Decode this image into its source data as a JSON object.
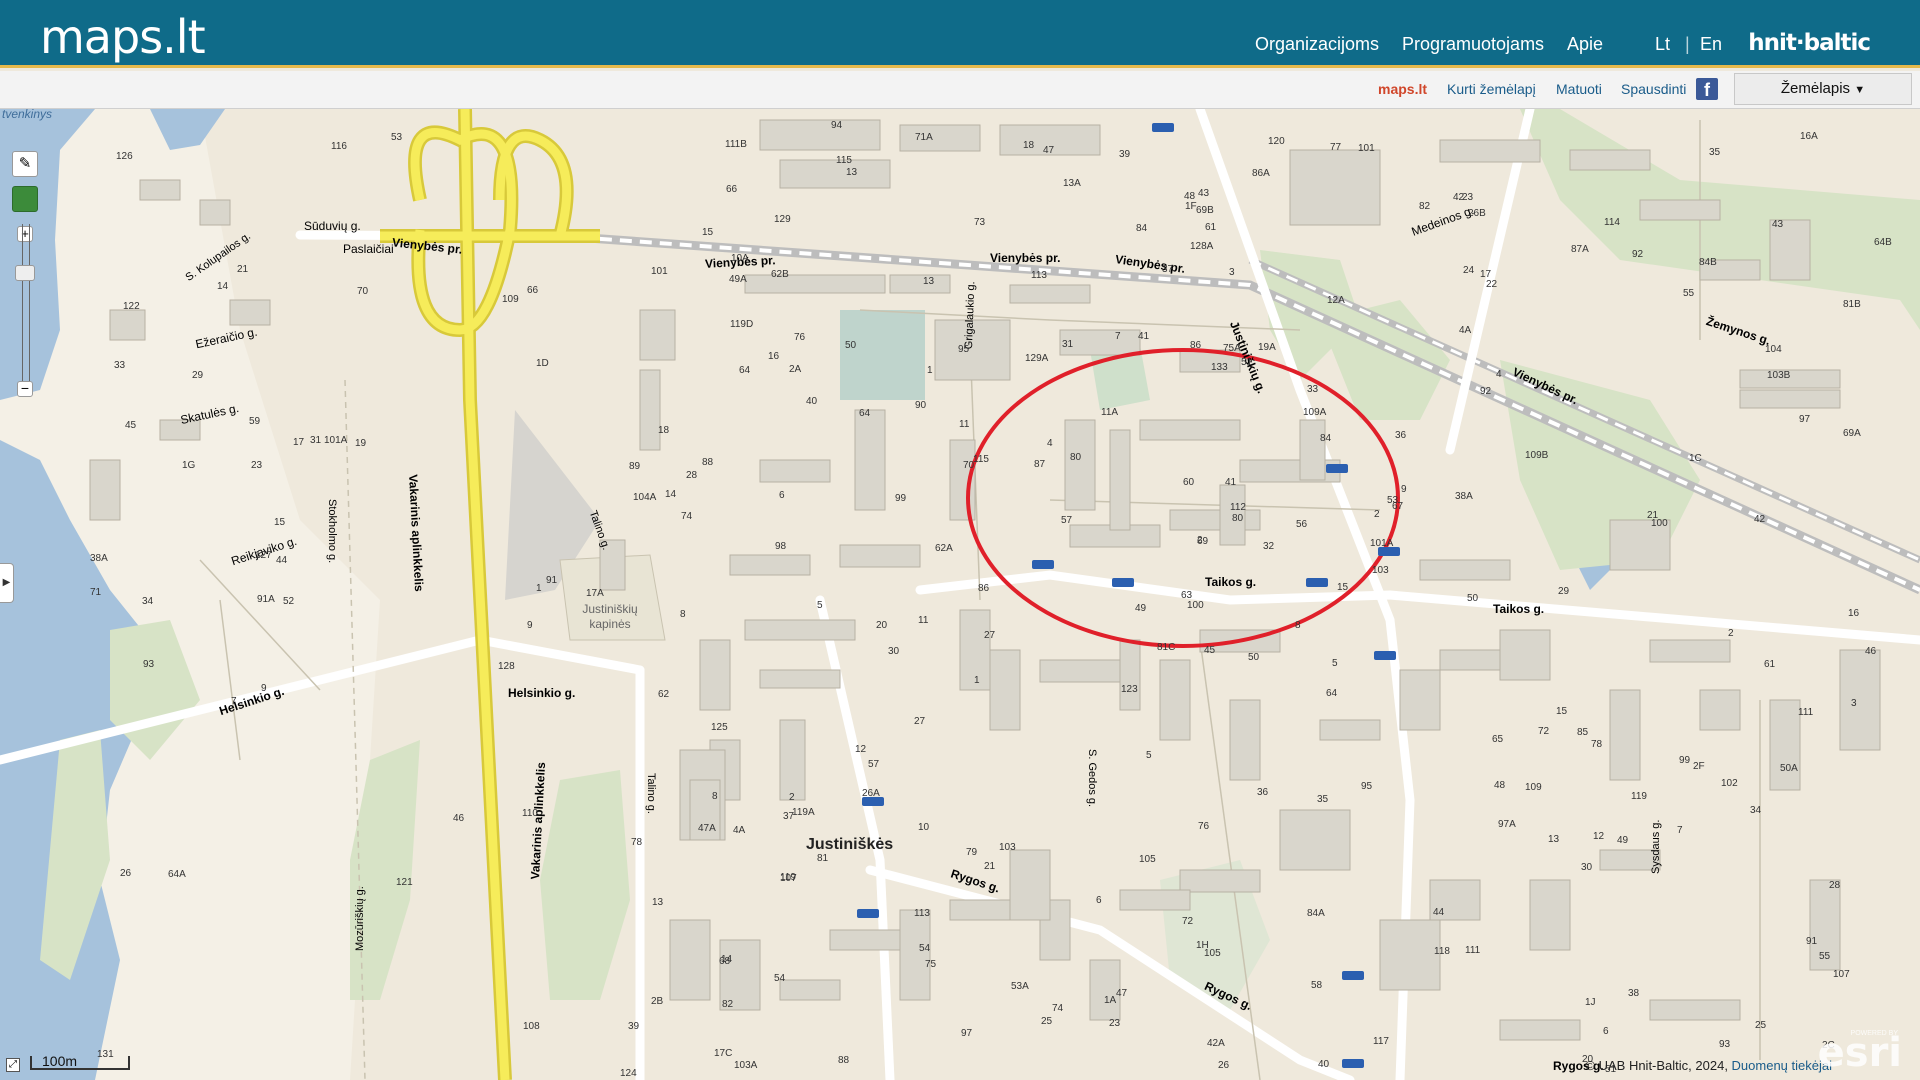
{
  "header": {
    "logo": "maps.lt",
    "nav": [
      "Organizacijoms",
      "Programuotojams",
      "Apie"
    ],
    "lang_lt": "Lt",
    "lang_sep": "|",
    "lang_en": "En",
    "brand": "hnit·baltic"
  },
  "toolbar": {
    "home": "maps.lt",
    "create_map": "Kurti žemėlapį",
    "measure": "Matuoti",
    "print": "Spausdinti",
    "facebook_icon": "facebook-icon",
    "layer_select": "Žemėlapis"
  },
  "map": {
    "district": "Justiniškės",
    "roads": [
      "Vienybės pr.",
      "Vakarinis aplinkkelis",
      "Taikos g.",
      "Rygos g.",
      "Justiniškių g.",
      "Helsinkio g.",
      "Reikjaviko g.",
      "Medeinos g.",
      "Žemynos g.",
      "Grigalaukio g.",
      "Stokholmo g.",
      "Talino g.",
      "Mozūriškių g.",
      "Sūduvių g.",
      "S. Gedos g.",
      "Sysdaus g.",
      "Ežeraičio g.",
      "Skatulės g.",
      "S. Kolupailos g.",
      "Paslaičiai"
    ],
    "poi": [
      "Justiniškių kapinės",
      "Buivydiškių VII tvenkinys"
    ],
    "house_numbers": [
      "50",
      "16",
      "100",
      "14",
      "2",
      "21",
      "23",
      "19A",
      "17",
      "15",
      "13",
      "2C",
      "98",
      "81B",
      "81C",
      "92",
      "88",
      "86",
      "84",
      "81",
      "80",
      "82",
      "75",
      "75A",
      "67",
      "78",
      "76",
      "69B",
      "74",
      "65",
      "69A",
      "63",
      "72",
      "69",
      "95",
      "87A",
      "79",
      "93",
      "91",
      "85",
      "77",
      "87",
      "99",
      "97A",
      "97",
      "89",
      "101A",
      "103A",
      "105",
      "103",
      "107",
      "103B",
      "101",
      "109",
      "111",
      "113",
      "115",
      "111B",
      "84A",
      "84B",
      "86A",
      "86",
      "88",
      "90",
      "92",
      "94",
      "82",
      "84",
      "80",
      "78",
      "76",
      "74",
      "72",
      "70",
      "68",
      "66",
      "64",
      "62",
      "60",
      "58",
      "56",
      "54",
      "50",
      "50A",
      "42A",
      "42",
      "36",
      "38",
      "40",
      "44",
      "48",
      "46",
      "38A",
      "30",
      "32",
      "34",
      "28",
      "26",
      "24",
      "22",
      "20",
      "18",
      "16",
      "14",
      "12",
      "10",
      "53A",
      "53",
      "55",
      "57",
      "61",
      "49A",
      "51",
      "49",
      "47",
      "47A",
      "45",
      "43",
      "41",
      "39",
      "37",
      "35",
      "33",
      "31",
      "29",
      "27",
      "25",
      "23",
      "21",
      "119D",
      "119A",
      "117",
      "115",
      "113",
      "111",
      "119",
      "1",
      "2",
      "3",
      "4",
      "5",
      "6",
      "7",
      "8",
      "9",
      "10A",
      "1A",
      "1J",
      "1H",
      "1F",
      "1C",
      "1D",
      "1G",
      "17C",
      "15",
      "13A",
      "13",
      "11",
      "9",
      "7",
      "5",
      "73",
      "71",
      "71A",
      "61",
      "59",
      "57",
      "55",
      "53",
      "51",
      "49",
      "47",
      "45",
      "43",
      "41",
      "39",
      "37",
      "35",
      "33",
      "31",
      "29",
      "27",
      "25",
      "23",
      "21",
      "19",
      "17",
      "15",
      "13",
      "11",
      "2F",
      "4A",
      "1",
      "4",
      "2",
      "54",
      "52",
      "50",
      "48",
      "46",
      "44",
      "42",
      "40",
      "38A",
      "36",
      "34",
      "30",
      "26",
      "26A",
      "26B",
      "28",
      "104",
      "104A",
      "102",
      "100",
      "119",
      "121",
      "123",
      "125",
      "127",
      "129",
      "129A",
      "131",
      "133",
      "108",
      "110",
      "112",
      "114",
      "116",
      "118",
      "120",
      "122",
      "124",
      "126",
      "128",
      "128A",
      "91",
      "91A",
      "93",
      "95",
      "97",
      "99",
      "101",
      "101A",
      "103",
      "105",
      "107",
      "109",
      "109A",
      "109B",
      "2A",
      "2B",
      "16A",
      "18",
      "20",
      "4A",
      "8",
      "6",
      "11A",
      "13",
      "12",
      "64",
      "64A",
      "64B",
      "62A",
      "62B",
      "64",
      "66",
      "70",
      "17A",
      "15",
      "12A",
      "14",
      "9",
      "8",
      "7",
      "6",
      "5",
      "3",
      "2",
      "1"
    ],
    "scale_label": "100m",
    "attribution_text": "© UAB Hnit-Baltic, 2024, ",
    "attribution_link": "Duomenų tiekėjai",
    "esri_logo": "esri",
    "esri_powered": "POWERED BY",
    "highlight_color": "#e0202a"
  },
  "colors": {
    "header_bg": "#0f6b89",
    "accent": "#e5b94c",
    "highway": "#f6ec5a",
    "water": "#a6c2dc",
    "park": "#c9dfb8",
    "building": "#d9d6cc"
  }
}
